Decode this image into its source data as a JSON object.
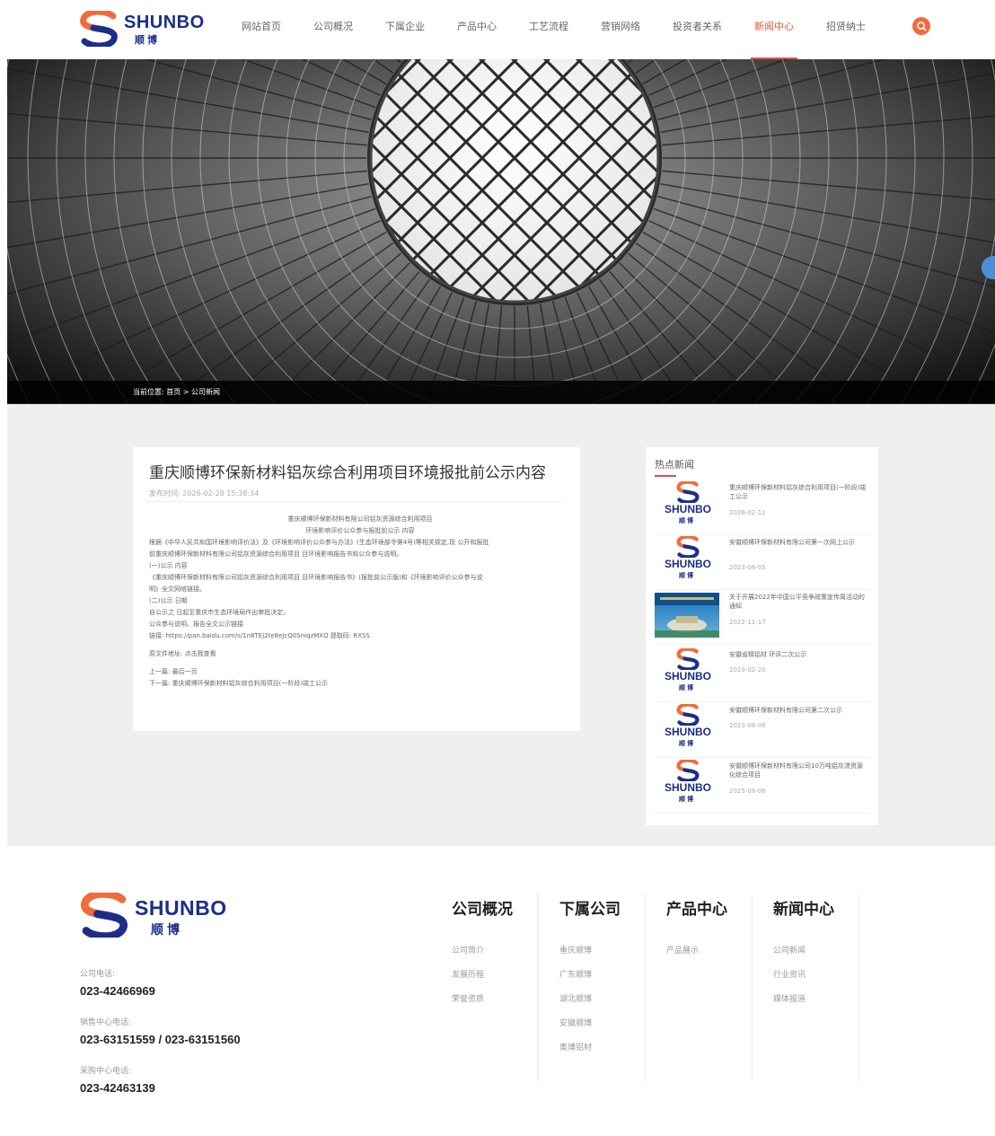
{
  "header": {
    "logo_text": "SHUNBO",
    "logo_cn": "顺博",
    "nav": [
      {
        "label": "网站首页",
        "active": false
      },
      {
        "label": "公司概况",
        "active": false
      },
      {
        "label": "下属企业",
        "active": false
      },
      {
        "label": "产品中心",
        "active": false
      },
      {
        "label": "工艺流程",
        "active": false
      },
      {
        "label": "营销网络",
        "active": false
      },
      {
        "label": "投资者关系",
        "active": false
      },
      {
        "label": "新闻中心",
        "active": true
      },
      {
        "label": "招贤纳士",
        "active": false
      }
    ]
  },
  "breadcrumb": "当前位置: 首页 > 公司新闻",
  "article": {
    "title": "重庆顺博环保新材料铝灰综合利用项目环境报批前公示内容",
    "date": "发布时间: 2026-02-28 15:38:34",
    "body": [
      {
        "text": "重庆顺博环保新材料有限公司铝灰资源综合利用项目",
        "style": "center"
      },
      {
        "text": "环境影响评价公众参与报批前公示 内容",
        "style": "center"
      },
      {
        "text": "根据《中华人民共和国环境影响评价法》及《环境影响评价公众参与办法》(生态环境部令第4号)等相关规定,现 公开和报批",
        "style": ""
      },
      {
        "text": "前重庆顺博环保新材料有限公司铝灰资源综合利用项目 目环境影响报告书和公众参与说明。",
        "style": ""
      },
      {
        "text": "(一)公示 内容",
        "style": ""
      },
      {
        "text": "《重庆顺博环保新材料有限公司铝灰资源综合利用项目 目环境影响报告书》(报批前公示版)和《环境影响评价公众参与说",
        "style": ""
      },
      {
        "text": "明》全文网络链接。",
        "style": ""
      },
      {
        "text": "(二)公示 日期",
        "style": ""
      },
      {
        "text": "自公示之 日起至重庆市生态环境局作出审批决定。",
        "style": ""
      },
      {
        "text": "公众参与说明、报告全文公示链接",
        "style": ""
      },
      {
        "text": "链接: https://pan.baidu.com/s/1n8TEj2te8eJcQ0SniqzMXQ 提取码: RXSS",
        "style": ""
      },
      {
        "text": "",
        "style": "gap"
      },
      {
        "text": "原文件地址: 点击我查看",
        "style": ""
      },
      {
        "text": "",
        "style": "gap"
      },
      {
        "text": "上一篇: 最后一页",
        "style": ""
      },
      {
        "text": "下一篇: 重庆顺博环保新材料铝灰综合利用项目(一阶段)竣工公示",
        "style": ""
      }
    ]
  },
  "hot_news": {
    "title": "热点新闻",
    "thumb_word": "SHUNBO",
    "thumb_cn": "顺博",
    "items": [
      {
        "text": "重庆顺博环保新材料铝灰综合利用项目(一阶段)竣工公示",
        "date": "2026-02-12",
        "thumb": "logo"
      },
      {
        "text": "安徽顺博环保新材料有限公司第一次网上公示",
        "date": "2023-06-05",
        "thumb": "logo"
      },
      {
        "text": "关于开展2022年中国公平竞争政策宣传周活动的通知",
        "date": "2022-11-17",
        "thumb": "photo"
      },
      {
        "text": "安徽省精铝材 环评二次公示",
        "date": "2023-02-20",
        "thumb": "logo"
      },
      {
        "text": "安徽顺博环保新材料有限公司第二次公示",
        "date": "2023-08-06",
        "thumb": "logo"
      },
      {
        "text": "安徽顺博环保新材料有限公司10万吨铝灰渣资源化综合项目",
        "date": "2025-08-06",
        "thumb": "logo"
      }
    ]
  },
  "footer": {
    "logo_text": "SHUNBO",
    "logo_cn": "顺博",
    "contacts": [
      {
        "label": "公司电话:",
        "value": "023-42466969"
      },
      {
        "label": "销售中心电话:",
        "value": "023-63151559 / 023-63151560"
      },
      {
        "label": "采购中心电话:",
        "value": "023-42463139"
      }
    ],
    "columns": [
      {
        "title": "公司概况",
        "links": [
          "公司简介",
          "发展历程",
          "荣誉资质"
        ]
      },
      {
        "title": "下属公司",
        "links": [
          "重庆顺博",
          "广东顺博",
          "湖北顺博",
          "安徽顺博",
          "奥博铝材"
        ]
      },
      {
        "title": "产品中心",
        "links": [
          "产品展示"
        ]
      },
      {
        "title": "新闻中心",
        "links": [
          "公司新闻",
          "行业资讯",
          "媒体报道"
        ]
      }
    ]
  },
  "colors": {
    "brand_blue": "#1b2f8a",
    "brand_orange": "#f26b3a",
    "active_nav": "#e2573c"
  }
}
